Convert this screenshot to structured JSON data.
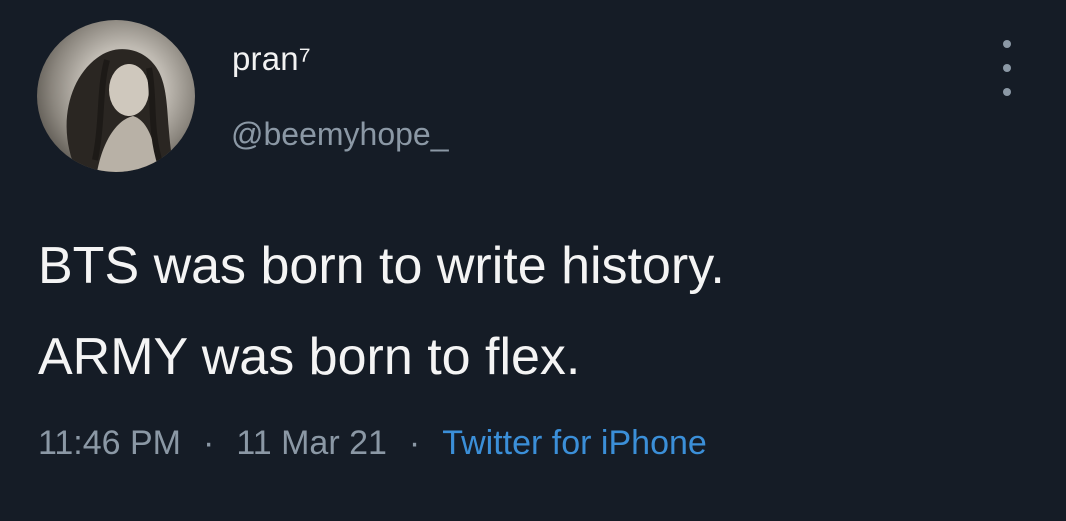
{
  "tweet": {
    "display_name": "pran⁷",
    "handle": "@beemyhope_",
    "text_line1": "BTS was born to write history.",
    "text_line2": "ARMY was born to flex.",
    "time": "11:46 PM",
    "separator": "·",
    "date": "11 Mar 21",
    "source": "Twitter for iPhone",
    "more_icon": "vertical-ellipsis-icon"
  },
  "colors": {
    "background": "#151c26",
    "text": "#f4f4f4",
    "secondary": "#8b98a5",
    "link": "#3b8fd8"
  }
}
